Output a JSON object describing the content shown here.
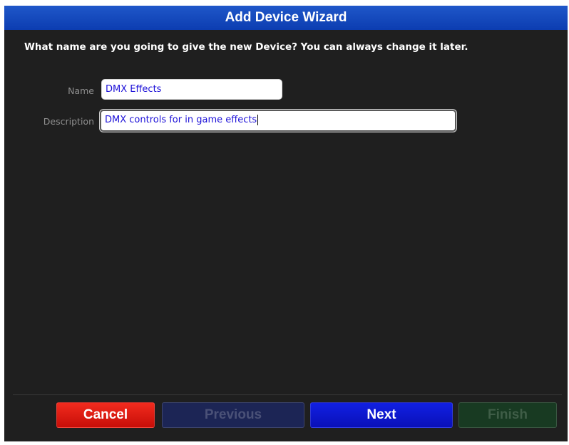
{
  "window": {
    "title": "Add Device Wizard"
  },
  "prompt": "What name are you going to give the new Device? You can always change it later.",
  "fields": {
    "name": {
      "label": "Name",
      "value": "DMX Effects"
    },
    "description": {
      "label": "Description",
      "value": "DMX controls for in game effects"
    }
  },
  "buttons": {
    "cancel": "Cancel",
    "previous": "Previous",
    "next": "Next",
    "finish": "Finish"
  },
  "colors": {
    "title_bar": "#0c3db1",
    "background": "#1f1f1f",
    "input_text": "#1c10d8",
    "cancel": "#e01812",
    "next": "#0d18d0",
    "previous_disabled": "#1c2555",
    "finish_disabled": "#183a22"
  },
  "state": {
    "previous_enabled": false,
    "finish_enabled": false,
    "focused_field": "description"
  }
}
